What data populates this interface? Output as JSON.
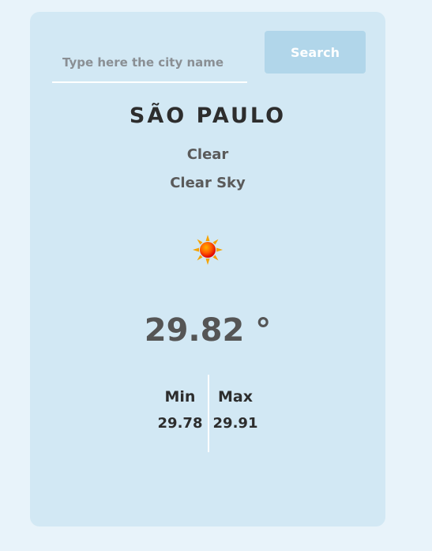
{
  "search": {
    "placeholder": "Type here the city name",
    "value": "",
    "button_label": "Search"
  },
  "weather": {
    "city": "SÃO PAULO",
    "condition": "Clear",
    "description": "Clear Sky",
    "icon": "sun-icon",
    "temperature": "29.82 °",
    "min_label": "Min",
    "min_value": "29.78",
    "max_label": "Max",
    "max_value": "29.91"
  },
  "colors": {
    "page_background": "#e8f3fa",
    "card_background": "#d2e8f4",
    "button_background": "#b1d6ea",
    "text_dark": "#2d2d2d",
    "text_muted": "#5a5a5a"
  }
}
